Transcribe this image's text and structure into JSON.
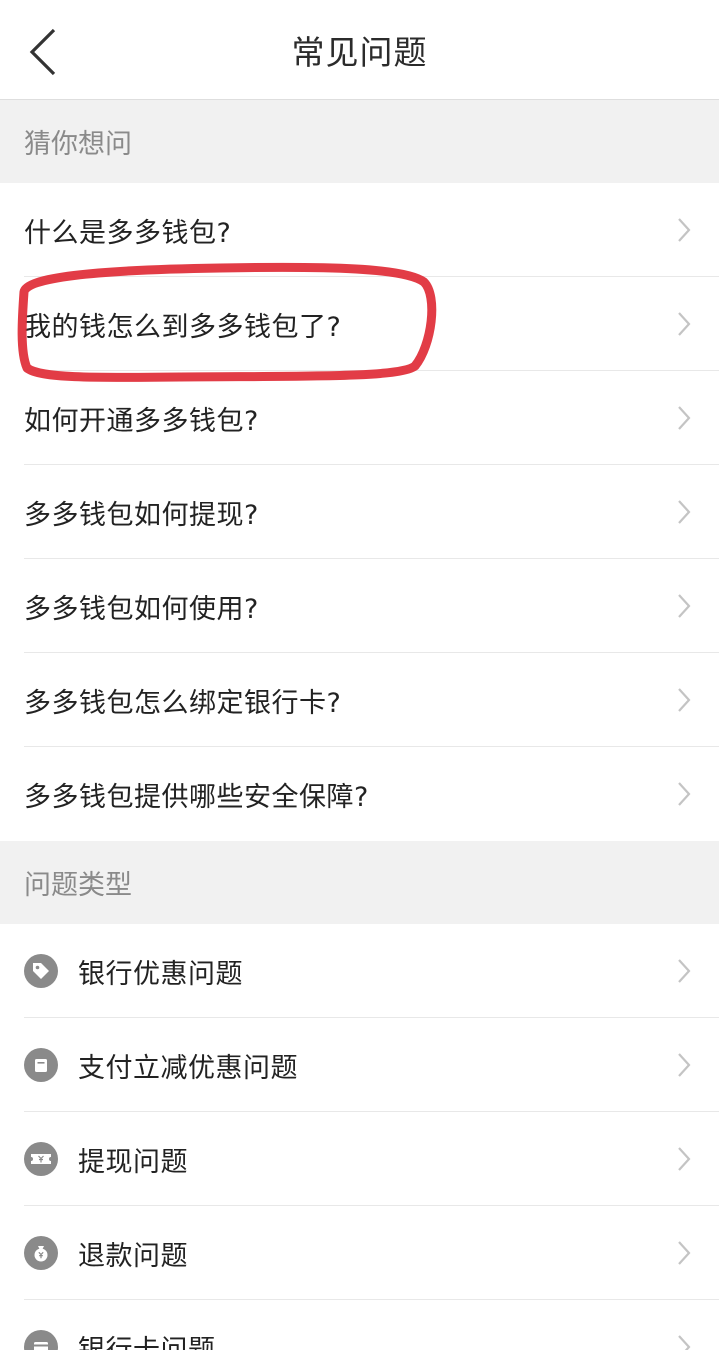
{
  "navbar": {
    "title": "常见问题",
    "back_icon": "chevron-left-icon"
  },
  "guess_section": {
    "header": "猜你想问",
    "items": [
      {
        "label": "什么是多多钱包?"
      },
      {
        "label": "我的钱怎么到多多钱包了?"
      },
      {
        "label": "如何开通多多钱包?"
      },
      {
        "label": "多多钱包如何提现?"
      },
      {
        "label": "多多钱包如何使用?"
      },
      {
        "label": "多多钱包怎么绑定银行卡?"
      },
      {
        "label": "多多钱包提供哪些安全保障?"
      }
    ]
  },
  "types_section": {
    "header": "问题类型",
    "items": [
      {
        "label": "银行优惠问题",
        "icon": "tag-icon"
      },
      {
        "label": "支付立减优惠问题",
        "icon": "bag-icon"
      },
      {
        "label": "提现问题",
        "icon": "ticket-icon"
      },
      {
        "label": "退款问题",
        "icon": "money-bag-icon"
      },
      {
        "label": "银行卡问题",
        "icon": "bank-card-icon"
      }
    ]
  },
  "colors": {
    "annotation": "#e0313c",
    "section_bg": "#f1f1f1",
    "icon_gray": "#8a8a8a",
    "chevron": "#c4c4c4"
  }
}
